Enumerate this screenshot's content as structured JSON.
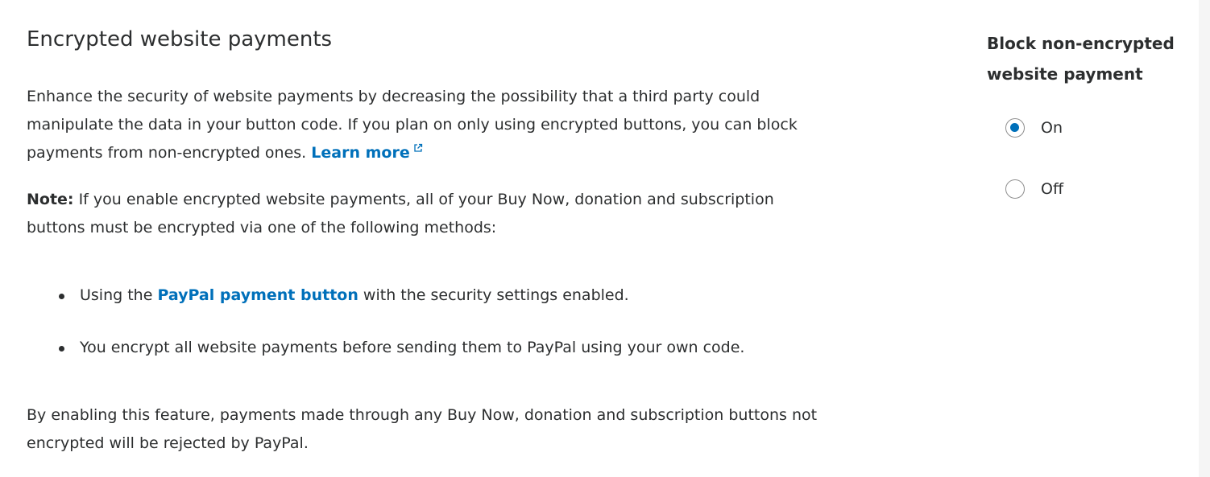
{
  "header": {
    "title": "Encrypted website payments"
  },
  "intro": {
    "text": "Enhance the security of website payments by decreasing the possibility that a third party could manipulate the data in your button code. If you plan on only using encrypted buttons, you can block payments from non-encrypted ones.",
    "learn_more_label": "Learn more",
    "learn_more_icon": "external-link-icon"
  },
  "note": {
    "label": "Note:",
    "text": "If you enable encrypted website payments, all of your Buy Now, donation and subscription buttons must be encrypted via one of the following methods:"
  },
  "methods": {
    "item1_prefix": "Using the",
    "item1_link": "PayPal payment button",
    "item1_suffix": "with the security settings enabled.",
    "item2": "You encrypt all website payments before sending them to PayPal using your own code."
  },
  "closing": {
    "text": "By enabling this feature, payments made through any Buy Now, donation and subscription buttons not encrypted will be rejected by PayPal."
  },
  "setting": {
    "title": "Block non-encrypted website payment",
    "options": [
      {
        "label": "On",
        "selected": true
      },
      {
        "label": "Off",
        "selected": false
      }
    ]
  },
  "colors": {
    "link": "#0070ba",
    "text": "#2c2e2f",
    "radio_selected": "#0070ba"
  }
}
